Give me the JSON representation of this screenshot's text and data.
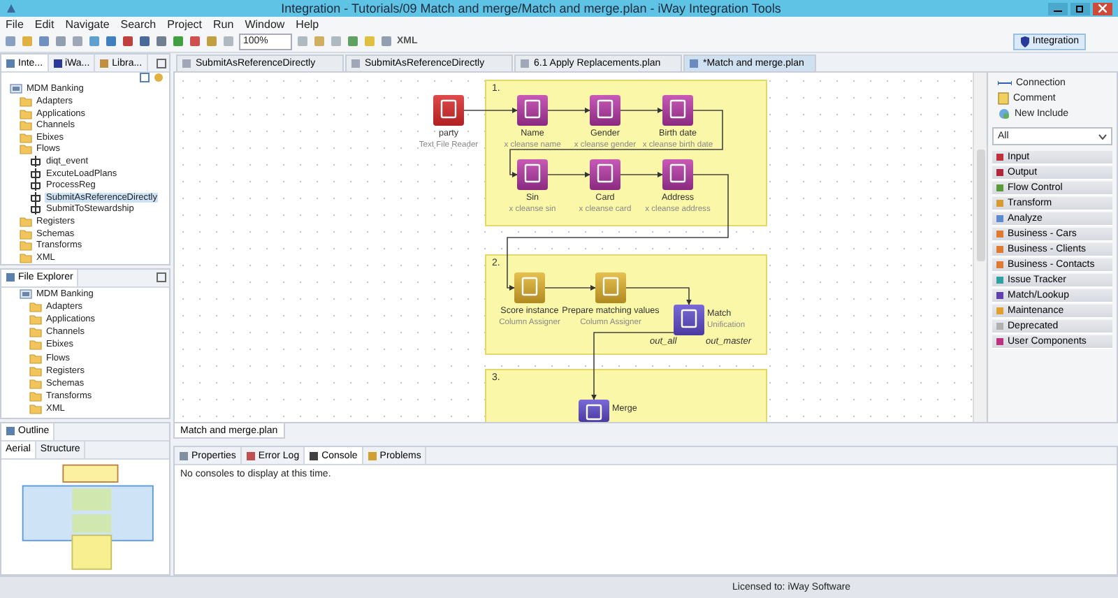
{
  "window": {
    "title": "Integration - Tutorials/09 Match and merge/Match and merge.plan - iWay Integration Tools"
  },
  "menu": [
    "File",
    "Edit",
    "Navigate",
    "Search",
    "Project",
    "Run",
    "Window",
    "Help"
  ],
  "toolbar": {
    "zoom": "100%",
    "xml_label": "XML",
    "perspective": "Integration"
  },
  "explorer": {
    "tabs": [
      {
        "label": "Inte...",
        "selected": true
      },
      {
        "label": "iWa...",
        "selected": false
      },
      {
        "label": "Libra...",
        "selected": false
      }
    ],
    "tree": [
      {
        "label": "MDM Banking",
        "kind": "project",
        "selected": false,
        "children": [
          {
            "label": "Adapters",
            "kind": "folder",
            "selected": false
          },
          {
            "label": "Applications",
            "kind": "folder",
            "selected": false
          },
          {
            "label": "Channels",
            "kind": "folder",
            "selected": false
          },
          {
            "label": "Ebixes",
            "kind": "folder",
            "selected": false
          },
          {
            "label": "Flows",
            "kind": "folder",
            "selected": false,
            "children": [
              {
                "label": "diqt_event",
                "kind": "flow",
                "selected": false
              },
              {
                "label": "ExcuteLoadPlans",
                "kind": "flow",
                "selected": false
              },
              {
                "label": "ProcessReg",
                "kind": "flow",
                "selected": false
              },
              {
                "label": "SubmitAsReferenceDirectly",
                "kind": "flow",
                "selected": true
              },
              {
                "label": "SubmitToStewardship",
                "kind": "flow",
                "selected": false
              }
            ]
          },
          {
            "label": "Registers",
            "kind": "folder",
            "selected": false
          },
          {
            "label": "Schemas",
            "kind": "folder",
            "selected": false
          },
          {
            "label": "Transforms",
            "kind": "folder",
            "selected": false
          },
          {
            "label": "XML",
            "kind": "folder",
            "selected": false
          }
        ]
      }
    ]
  },
  "file_explorer": {
    "title": "File Explorer",
    "tree": [
      {
        "label": "MDM Banking",
        "kind": "project",
        "selected": false,
        "children": [
          {
            "label": "Adapters",
            "kind": "folder",
            "selected": false
          },
          {
            "label": "Applications",
            "kind": "folder",
            "selected": false
          },
          {
            "label": "Channels",
            "kind": "folder",
            "selected": false
          },
          {
            "label": "Ebixes",
            "kind": "folder",
            "selected": false
          },
          {
            "label": "Flows",
            "kind": "folder",
            "selected": false
          },
          {
            "label": "Registers",
            "kind": "folder",
            "selected": false
          },
          {
            "label": "Schemas",
            "kind": "folder",
            "selected": false
          },
          {
            "label": "Transforms",
            "kind": "folder",
            "selected": false
          },
          {
            "label": "XML",
            "kind": "folder",
            "selected": false
          }
        ]
      }
    ]
  },
  "outline": {
    "title": "Outline",
    "tabs": [
      {
        "label": "Aerial",
        "selected": true
      },
      {
        "label": "Structure",
        "selected": false
      }
    ]
  },
  "editor_tabs": [
    {
      "label": "SubmitAsReferenceDirectly",
      "selected": false
    },
    {
      "label": "SubmitAsReferenceDirectly",
      "selected": false
    },
    {
      "label": "6.1 Apply Replacements.plan",
      "selected": false
    },
    {
      "label": "*Match and merge.plan",
      "selected": true
    }
  ],
  "diagram": {
    "groups": [
      {
        "label": "1."
      },
      {
        "label": "2."
      },
      {
        "label": "3."
      }
    ],
    "nodes": [
      {
        "kind": "reader",
        "title": "party",
        "subtitle": "Text File Reader"
      },
      {
        "kind": "cleanse",
        "title": "Name",
        "subtitle": "x cleanse name"
      },
      {
        "kind": "cleanse",
        "title": "Gender",
        "subtitle": "x cleanse gender"
      },
      {
        "kind": "cleanse",
        "title": "Birth date",
        "subtitle": "x cleanse birth date"
      },
      {
        "kind": "cleanse",
        "title": "Sin",
        "subtitle": "x cleanse sin"
      },
      {
        "kind": "cleanse",
        "title": "Card",
        "subtitle": "x cleanse card"
      },
      {
        "kind": "cleanse",
        "title": "Address",
        "subtitle": "x cleanse address"
      },
      {
        "kind": "assigner",
        "title": "Score instance",
        "subtitle": "Column Assigner"
      },
      {
        "kind": "assigner",
        "title": "Prepare matching values",
        "subtitle": "Column Assigner"
      },
      {
        "kind": "unify",
        "title": "Match",
        "subtitle": "Unification"
      },
      {
        "kind": "merge",
        "title": "Merge"
      }
    ],
    "ports": [
      "out_all",
      "out_master"
    ]
  },
  "palette": {
    "tools": [
      {
        "label": "Connection",
        "kind": "connection"
      },
      {
        "label": "Comment",
        "kind": "comment"
      },
      {
        "label": "New Include",
        "kind": "include"
      }
    ],
    "filter": "All",
    "drawers": [
      {
        "label": "Input",
        "color": "#c0303a"
      },
      {
        "label": "Output",
        "color": "#b02838"
      },
      {
        "label": "Flow Control",
        "color": "#5a9a3a"
      },
      {
        "label": "Transform",
        "color": "#d89a30"
      },
      {
        "label": "Analyze",
        "color": "#5a8ad0"
      },
      {
        "label": "Business - Cars",
        "color": "#e07a30"
      },
      {
        "label": "Business - Clients",
        "color": "#e07a31"
      },
      {
        "label": "Business - Contacts",
        "color": "#e07a32"
      },
      {
        "label": "Issue Tracker",
        "color": "#30a0a0"
      },
      {
        "label": "Match/Lookup",
        "color": "#6040b0"
      },
      {
        "label": "Maintenance",
        "color": "#e0a030"
      },
      {
        "label": "Deprecated",
        "color": "#b0b0b0"
      },
      {
        "label": "User Components",
        "color": "#c03080"
      }
    ]
  },
  "editor_page_tab": "Match and merge.plan",
  "bottom_panel": {
    "tabs": [
      {
        "label": "Properties",
        "selected": false
      },
      {
        "label": "Error Log",
        "selected": false
      },
      {
        "label": "Console",
        "selected": true
      },
      {
        "label": "Problems",
        "selected": false
      }
    ],
    "message": "No consoles to display at this time."
  },
  "status_bar": {
    "license": "Licensed to: iWay Software"
  }
}
